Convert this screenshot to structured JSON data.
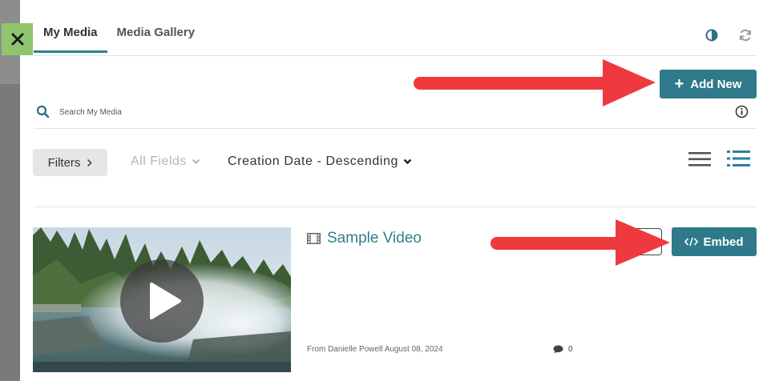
{
  "tabs": [
    {
      "label": "My Media",
      "active": true
    },
    {
      "label": "Media Gallery",
      "active": false
    }
  ],
  "toolbar": {
    "add_new_label": "Add New",
    "contrast_icon": "contrast-icon",
    "refresh_icon": "refresh-icon"
  },
  "search": {
    "placeholder": "Search My Media",
    "icon": "search-icon"
  },
  "filters": {
    "filters_label": "Filters",
    "fields_label": "All Fields",
    "sort_label": "Creation Date - Descending"
  },
  "entry": {
    "title": "Sample Video",
    "meta": "From Danielle Powell August 08, 2024",
    "comments": "0",
    "embed_label": "Embed"
  },
  "colors": {
    "accent": "#2f7a8a",
    "close_bg": "#8fc56f",
    "arrow": "#ee3a3f"
  }
}
